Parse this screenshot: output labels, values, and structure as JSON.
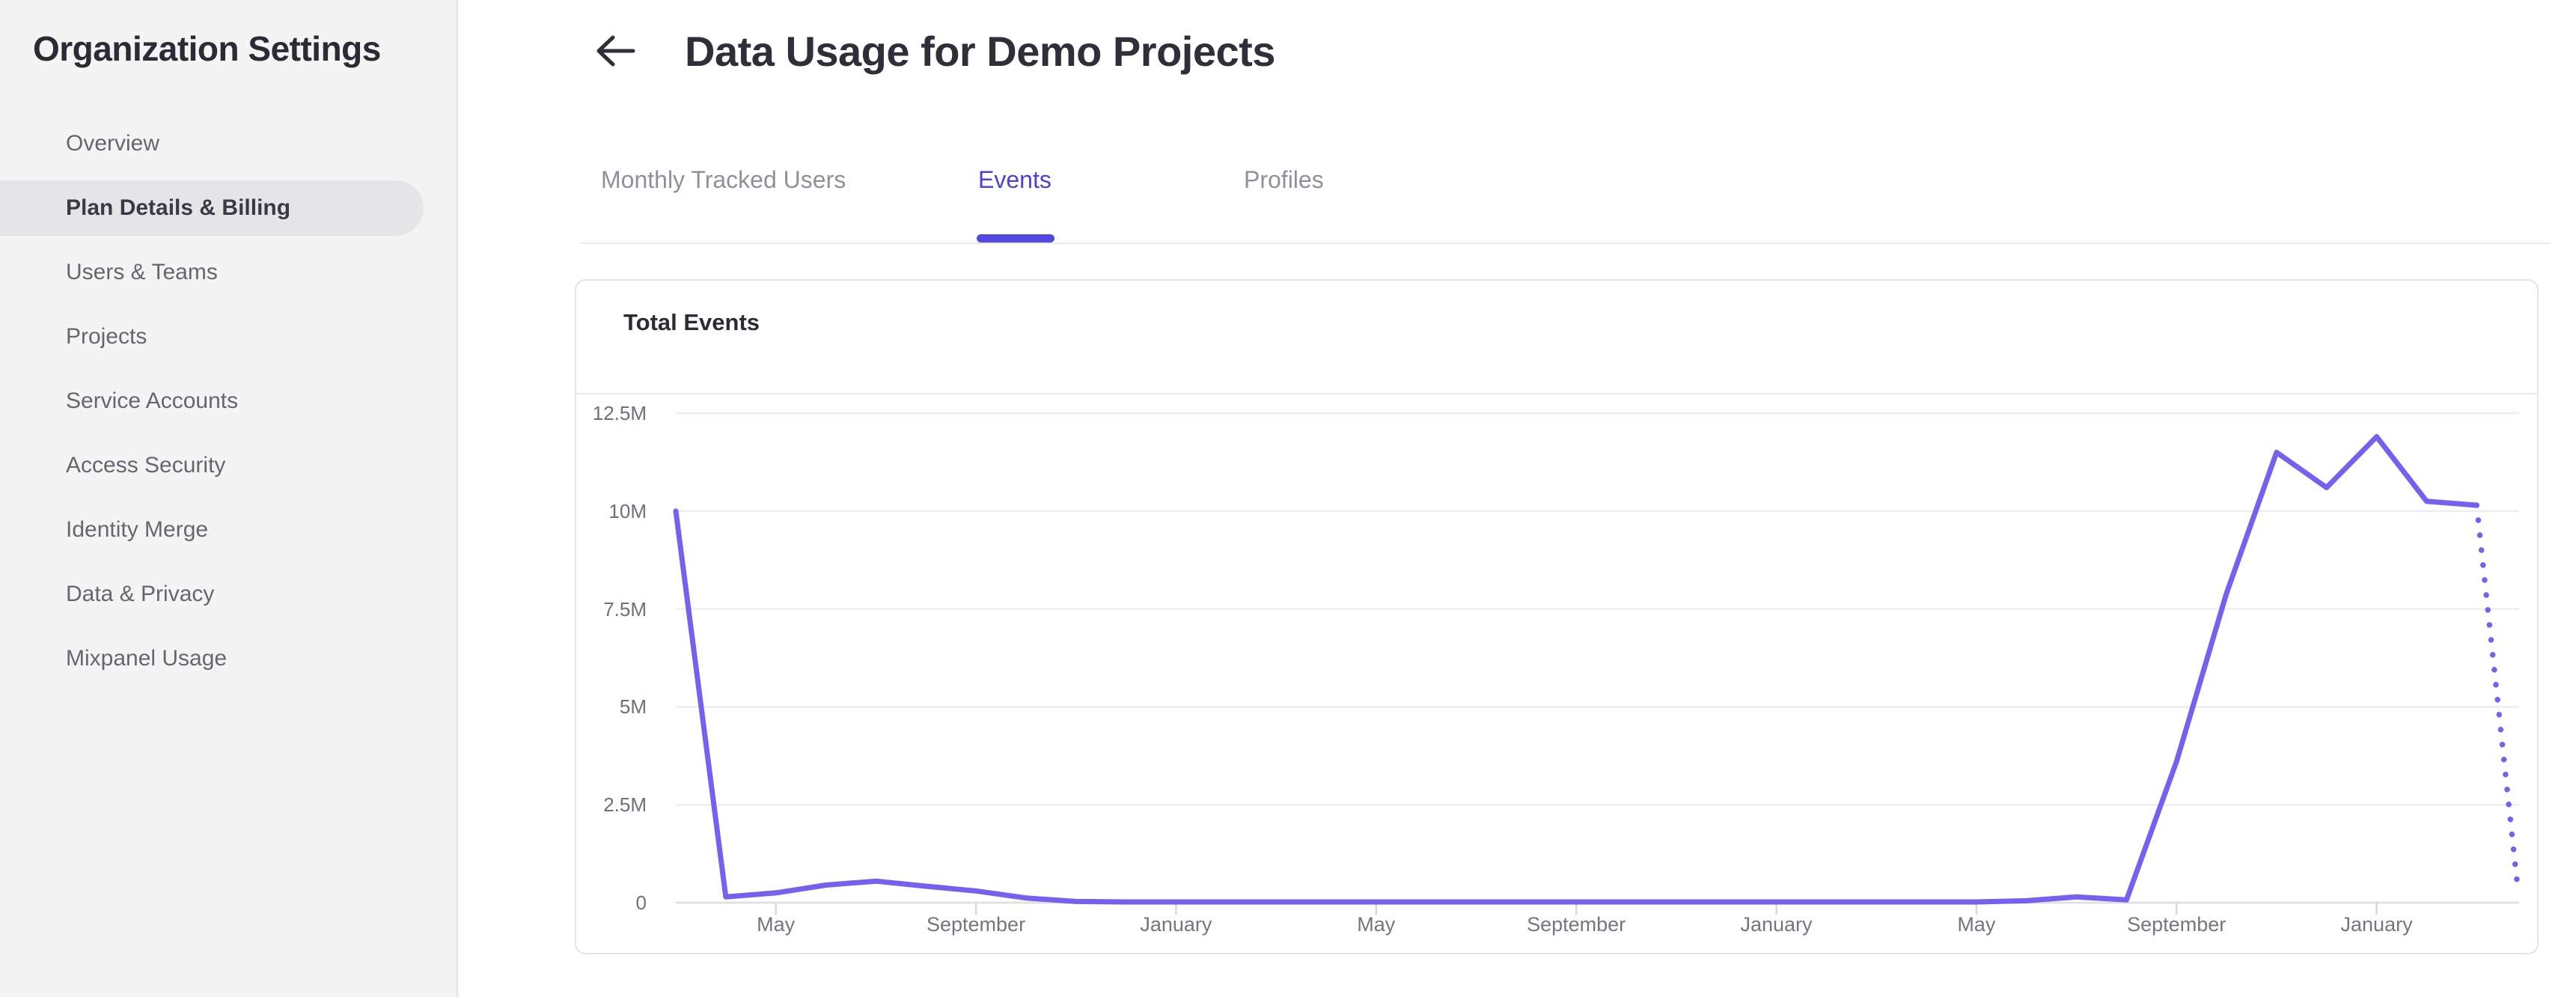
{
  "sidebar": {
    "title": "Organization Settings",
    "items": [
      {
        "label": "Overview",
        "active": false
      },
      {
        "label": "Plan Details & Billing",
        "active": true
      },
      {
        "label": "Users & Teams",
        "active": false
      },
      {
        "label": "Projects",
        "active": false
      },
      {
        "label": "Service Accounts",
        "active": false
      },
      {
        "label": "Access Security",
        "active": false
      },
      {
        "label": "Identity Merge",
        "active": false
      },
      {
        "label": "Data & Privacy",
        "active": false
      },
      {
        "label": "Mixpanel Usage",
        "active": false
      }
    ]
  },
  "header": {
    "title": "Data Usage for Demo Projects"
  },
  "tabs": [
    {
      "label": "Monthly Tracked Users",
      "active": false
    },
    {
      "label": "Events",
      "active": true
    },
    {
      "label": "Profiles",
      "active": false
    }
  ],
  "card": {
    "title": "Total Events"
  },
  "chart_data": {
    "type": "line",
    "title": "Total Events",
    "ylabel": "",
    "xlabel": "",
    "ylim_events": [
      0,
      12500000
    ],
    "y_ticks": [
      "12.5M",
      "10M",
      "7.5M",
      "5M",
      "2.5M",
      "0"
    ],
    "y_tick_values_millions": [
      12.5,
      10,
      7.5,
      5,
      2.5,
      0
    ],
    "x_tick_labels": [
      "May",
      "September",
      "January",
      "May",
      "September",
      "January",
      "May",
      "September",
      "January"
    ],
    "x_tick_indices": [
      2,
      6,
      10,
      14,
      18,
      22,
      26,
      30,
      34
    ],
    "cadence": "monthly",
    "first_point_month": "March",
    "values_millions": [
      10,
      0.15,
      0.25,
      0.45,
      0.55,
      0.42,
      0.3,
      0.12,
      0.03,
      0.02,
      0.02,
      0.02,
      0.02,
      0.02,
      0.02,
      0.02,
      0.02,
      0.02,
      0.02,
      0.02,
      0.02,
      0.02,
      0.02,
      0.02,
      0.02,
      0.02,
      0.02,
      0.05,
      0.15,
      0.07,
      3.6,
      7.9,
      11.5,
      10.6,
      11.9,
      10.25,
      10.15,
      0.4
    ],
    "last_point_style": "dotted_incomplete_period",
    "grid": true,
    "legend": "none"
  },
  "colors": {
    "line": "#7560f0",
    "active_tab_text": "#4c41dd",
    "tab_underline": "#5348e0",
    "sidebar_bg": "#f4f4f5",
    "sidebar_active_pill": "#e5e5e8",
    "gridline": "#eeeef0",
    "axis_line": "#e1e1e4",
    "tick_mark": "#d8d8da"
  }
}
